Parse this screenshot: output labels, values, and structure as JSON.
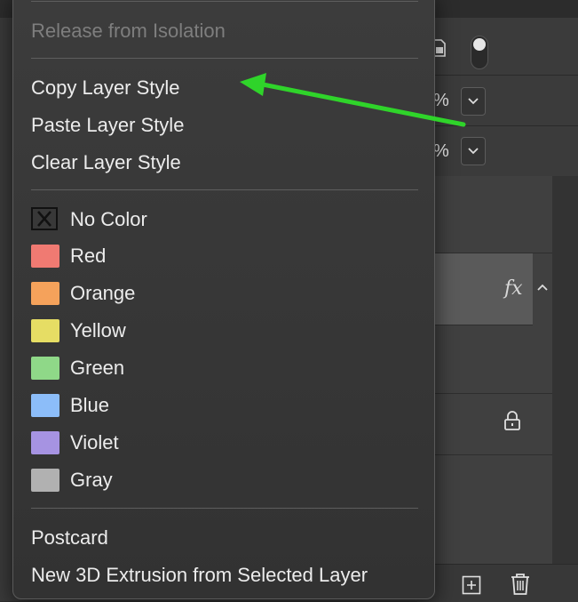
{
  "menu": {
    "isolation_item": "Release from Isolation",
    "style_items": [
      "Copy Layer Style",
      "Paste Layer Style",
      "Clear Layer Style"
    ],
    "no_color_label": "No Color",
    "colors": [
      {
        "label": "Red",
        "color": "#f07a72"
      },
      {
        "label": "Orange",
        "color": "#f5a25b"
      },
      {
        "label": "Yellow",
        "color": "#e6dd64"
      },
      {
        "label": "Green",
        "color": "#8fd888"
      },
      {
        "label": "Blue",
        "color": "#8cbdf9"
      },
      {
        "label": "Violet",
        "color": "#a693e2"
      },
      {
        "label": "Gray",
        "color": "#b1b1b1"
      }
    ],
    "postcard_item": "Postcard",
    "extrusion_item": "New 3D Extrusion from Selected Layer"
  },
  "panel": {
    "opacity_suffix": "%",
    "fill_suffix": "%",
    "fx_label": "fx"
  },
  "annotation": {
    "arrow_color": "#2fd42a"
  }
}
